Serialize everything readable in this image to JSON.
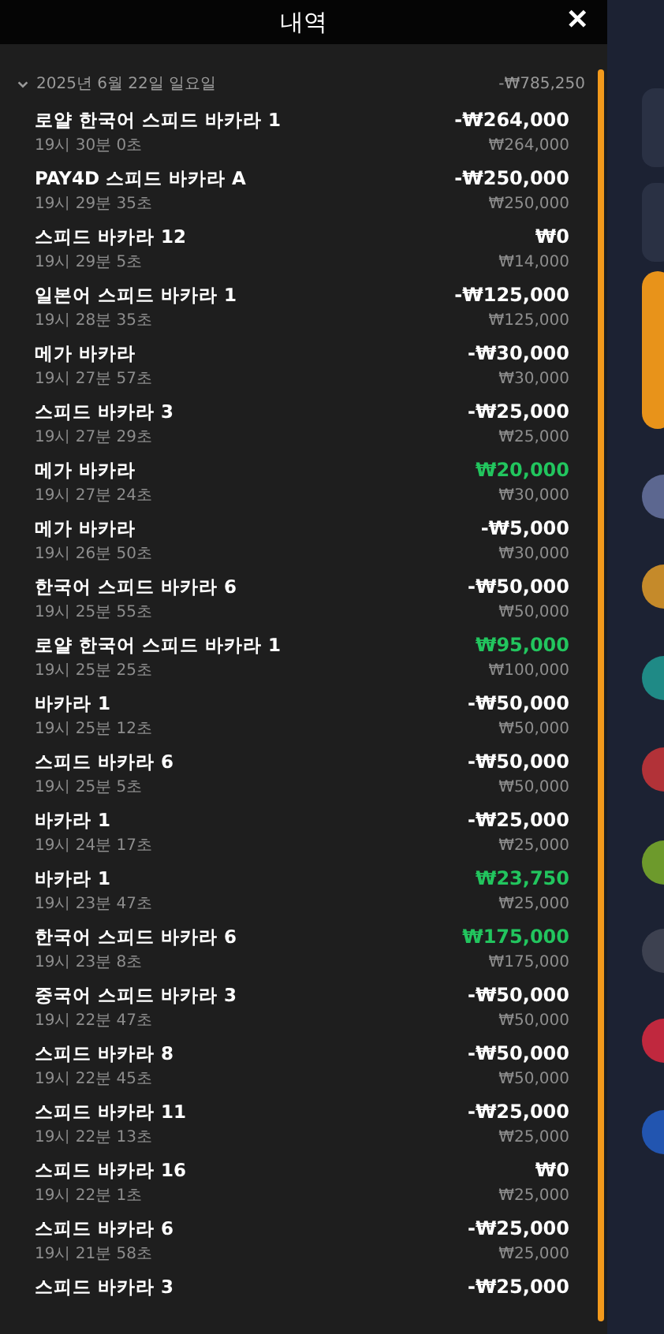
{
  "header": {
    "title": "내역",
    "close": "✕"
  },
  "date_group": {
    "label": "2025년 6월 22일 일요일",
    "total": "-₩785,250",
    "expanded": true
  },
  "rows": [
    {
      "game": "로얄 한국어 스피드 바카라 1",
      "time": "19시 30분 0초",
      "result": "-₩264,000",
      "stake": "₩264,000",
      "win": false
    },
    {
      "game": "PAY4D 스피드 바카라 A",
      "time": "19시 29분 35초",
      "result": "-₩250,000",
      "stake": "₩250,000",
      "win": false
    },
    {
      "game": "스피드 바카라 12",
      "time": "19시 29분 5초",
      "result": "₩0",
      "stake": "₩14,000",
      "win": false
    },
    {
      "game": "일본어 스피드 바카라 1",
      "time": "19시 28분 35초",
      "result": "-₩125,000",
      "stake": "₩125,000",
      "win": false
    },
    {
      "game": "메가 바카라",
      "time": "19시 27분 57초",
      "result": "-₩30,000",
      "stake": "₩30,000",
      "win": false
    },
    {
      "game": "스피드 바카라 3",
      "time": "19시 27분 29초",
      "result": "-₩25,000",
      "stake": "₩25,000",
      "win": false
    },
    {
      "game": "메가 바카라",
      "time": "19시 27분 24초",
      "result": "₩20,000",
      "stake": "₩30,000",
      "win": true
    },
    {
      "game": "메가 바카라",
      "time": "19시 26분 50초",
      "result": "-₩5,000",
      "stake": "₩30,000",
      "win": false
    },
    {
      "game": "한국어 스피드 바카라 6",
      "time": "19시 25분 55초",
      "result": "-₩50,000",
      "stake": "₩50,000",
      "win": false
    },
    {
      "game": "로얄 한국어 스피드 바카라 1",
      "time": "19시 25분 25초",
      "result": "₩95,000",
      "stake": "₩100,000",
      "win": true
    },
    {
      "game": "바카라 1",
      "time": "19시 25분 12초",
      "result": "-₩50,000",
      "stake": "₩50,000",
      "win": false
    },
    {
      "game": "스피드 바카라 6",
      "time": "19시 25분 5초",
      "result": "-₩50,000",
      "stake": "₩50,000",
      "win": false
    },
    {
      "game": "바카라 1",
      "time": "19시 24분 17초",
      "result": "-₩25,000",
      "stake": "₩25,000",
      "win": false
    },
    {
      "game": "바카라 1",
      "time": "19시 23분 47초",
      "result": "₩23,750",
      "stake": "₩25,000",
      "win": true
    },
    {
      "game": "한국어 스피드 바카라 6",
      "time": "19시 23분 8초",
      "result": "₩175,000",
      "stake": "₩175,000",
      "win": true
    },
    {
      "game": "중국어 스피드 바카라 3",
      "time": "19시 22분 47초",
      "result": "-₩50,000",
      "stake": "₩50,000",
      "win": false
    },
    {
      "game": "스피드 바카라 8",
      "time": "19시 22분 45초",
      "result": "-₩50,000",
      "stake": "₩50,000",
      "win": false
    },
    {
      "game": "스피드 바카라 11",
      "time": "19시 22분 13초",
      "result": "-₩25,000",
      "stake": "₩25,000",
      "win": false
    },
    {
      "game": "스피드 바카라 16",
      "time": "19시 22분 1초",
      "result": "₩0",
      "stake": "₩25,000",
      "win": false
    },
    {
      "game": "스피드 바카라 6",
      "time": "19시 21분 58초",
      "result": "-₩25,000",
      "stake": "₩25,000",
      "win": false
    },
    {
      "game": "스피드 바카라 3",
      "result": "-₩25,000",
      "win": false
    }
  ]
}
